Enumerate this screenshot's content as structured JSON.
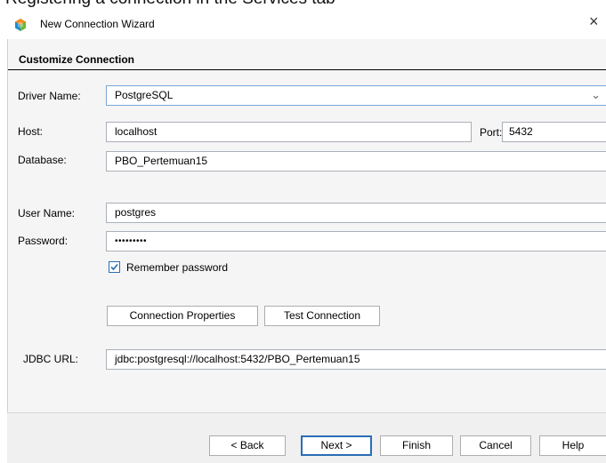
{
  "top_fragment": "Registering a connection in the Services tab",
  "window": {
    "title": "New Connection Wizard",
    "close_glyph": "×",
    "icon": "netbeans-cube-icon"
  },
  "section": {
    "title": "Customize Connection"
  },
  "form": {
    "driver_label": "Driver Name:",
    "driver_value": "PostgreSQL",
    "host_label": "Host:",
    "host_value": "localhost",
    "port_label": "Port:",
    "port_value": "5432",
    "database_label": "Database:",
    "database_value": "PBO_Pertemuan15",
    "user_label": "User Name:",
    "user_value": "postgres",
    "password_label": "Password:",
    "password_value": "•••••••••",
    "remember_label": "Remember password",
    "remember_checked": true,
    "jdbc_label": "JDBC URL:",
    "jdbc_value": "jdbc:postgresql://localhost:5432/PBO_Pertemuan15"
  },
  "buttons": {
    "connection_properties": "Connection Properties",
    "test_connection": "Test Connection",
    "back": "< Back",
    "next": "Next >",
    "finish": "Finish",
    "cancel": "Cancel",
    "help": "Help"
  },
  "colors": {
    "accent": "#2a6db5",
    "panel_bg": "#f5f5f5",
    "footer_bg": "#f0f0f0"
  }
}
